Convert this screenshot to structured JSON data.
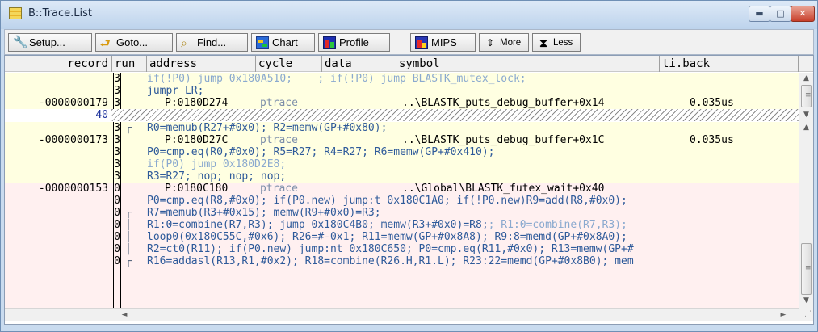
{
  "window": {
    "title": "B::Trace.List",
    "controls": {
      "minimize": "▬",
      "maximize": "□",
      "close": "✕"
    }
  },
  "toolbar": {
    "buttons": [
      {
        "label": "Setup...",
        "icon": "wrench-icon"
      },
      {
        "label": "Goto...",
        "icon": "goto-icon"
      },
      {
        "label": "Find...",
        "icon": "binoculars-icon"
      },
      {
        "label": "Chart",
        "icon": "chart-icon"
      },
      {
        "label": "Profile",
        "icon": "profile-icon"
      },
      {
        "label": "MIPS",
        "icon": "mips-icon"
      },
      {
        "label": "More",
        "icon": "more-icon"
      },
      {
        "label": "Less",
        "icon": "less-icon"
      }
    ]
  },
  "columns": {
    "record": "record",
    "run": "run",
    "address": "address",
    "cycle": "cycle",
    "data": "data",
    "symbol": "symbol",
    "tiback": "ti.back"
  },
  "trace": {
    "rows": [
      {
        "run": "3",
        "text": "if(!P0) jump 0x180A510;    ; if(!P0) jump BLASTK_mutex_lock;"
      },
      {
        "run": "3",
        "text": "jumpr LR;"
      },
      {
        "record": "-0000000179",
        "run": "3",
        "address": "P:0180D274",
        "cycle": "ptrace",
        "symbol": "..\\BLASTK_puts_debug_buffer+0x14",
        "tiback": "0.035us"
      },
      {
        "record": "40"
      },
      {
        "run": "3",
        "text": "R0=memub(R27+#0x0); R2=memw(GP+#0x80);"
      },
      {
        "record": "-0000000173",
        "run": "3",
        "address": "P:0180D27C",
        "cycle": "ptrace",
        "symbol": "..\\BLASTK_puts_debug_buffer+0x1C",
        "tiback": "0.035us"
      },
      {
        "run": "3",
        "text": "P0=cmp.eq(R0,#0x0); R5=R27; R4=R27; R6=memw(GP+#0x410);"
      },
      {
        "run": "3",
        "text": "if(P0) jump 0x180D2E8;"
      },
      {
        "run": "3",
        "text": "R3=R27; nop; nop; nop;"
      },
      {
        "record": "-0000000153",
        "run": "0",
        "address": "P:0180C180",
        "cycle": "ptrace",
        "symbol": "..\\Global\\BLASTK_futex_wait+0x40"
      },
      {
        "run": "0",
        "text": "P0=cmp.eq(R8,#0x0); if(P0.new) jump:t 0x180C1A0; if(!P0.new)R9=add(R8,#0x0);"
      },
      {
        "run": "0",
        "text": "R7=memub(R3+#0x15); memw(R9+#0x0)=R3;"
      },
      {
        "run": "0",
        "text": "R1:0=combine(R7,R3); jump 0x180C4B0; memw(R3+#0x0)=R8;",
        "extra": "; R1:0=combine(R7,R3);"
      },
      {
        "run": "0",
        "text": "loop0(0x180C55C,#0x6); R26=#-0x1; R11=memw(GP+#0x8A8); R9:8=memd(GP+#0x8A0);"
      },
      {
        "run": "0",
        "text": "R2=ct0(R11); if(P0.new) jump:nt 0x180C650; P0=cmp.eq(R11,#0x0); R13=memw(GP+#"
      },
      {
        "run": "0",
        "text": "R16=addasl(R13,R1,#0x2); R18=combine(R26.H,R1.L); R23:22=memd(GP+#0x8B0); mem"
      }
    ]
  },
  "scrollbar": {
    "up": "▲",
    "down": "▼",
    "left": "◄",
    "right": "►",
    "grip": "≡"
  }
}
